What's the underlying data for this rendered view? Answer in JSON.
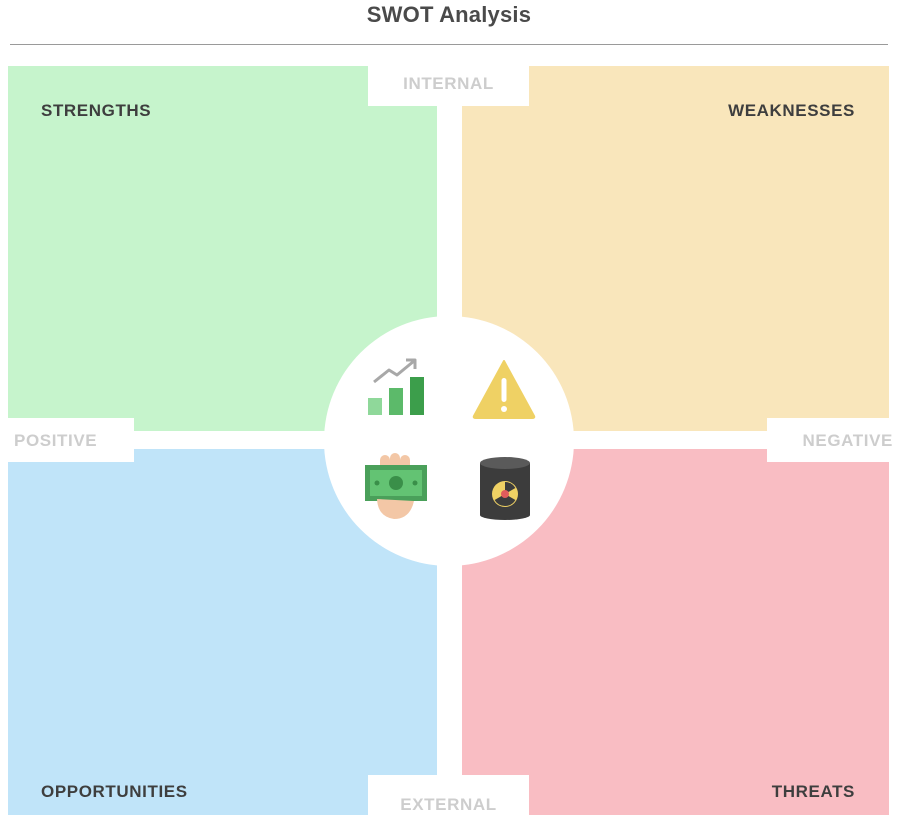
{
  "title": "SWOT Analysis",
  "quadrants": {
    "strengths": {
      "label": "STRENGTHS",
      "color": "#c6f4cc",
      "icon": "growth-chart-icon"
    },
    "weaknesses": {
      "label": "WEAKNESSES",
      "color": "#f9e6bb",
      "icon": "warning-icon"
    },
    "opportunities": {
      "label": "OPPORTUNITIES",
      "color": "#c0e4f9",
      "icon": "money-hand-icon"
    },
    "threats": {
      "label": "THREATS",
      "color": "#f9bdc3",
      "icon": "toxic-barrel-icon"
    }
  },
  "axes": {
    "top": "INTERNAL",
    "bottom": "EXTERNAL",
    "left": "POSITIVE",
    "right": "NEGATIVE"
  }
}
